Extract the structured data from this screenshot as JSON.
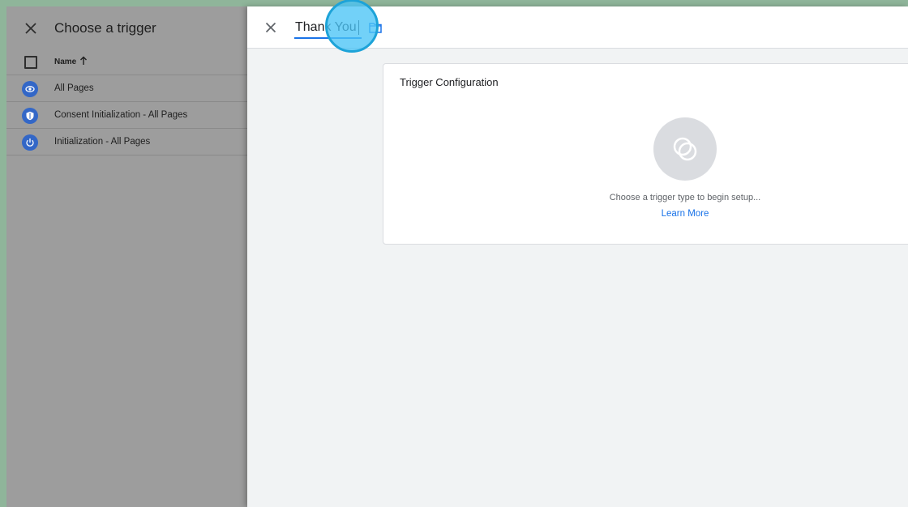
{
  "trigger_list": {
    "title": "Choose a trigger",
    "column_header": "Name",
    "rows": [
      {
        "label": "All Pages",
        "icon": "eye-icon"
      },
      {
        "label": "Consent Initialization - All Pages",
        "icon": "shield-icon"
      },
      {
        "label": "Initialization - All Pages",
        "icon": "power-icon"
      }
    ]
  },
  "editor": {
    "name_value": "Thank You",
    "card_title": "Trigger Configuration",
    "hint": "Choose a trigger type to begin setup...",
    "learn_more": "Learn More"
  },
  "colors": {
    "accent": "#1a73e8",
    "row_icon": "#3367c7",
    "click_indicator": "#4ac4f6"
  }
}
